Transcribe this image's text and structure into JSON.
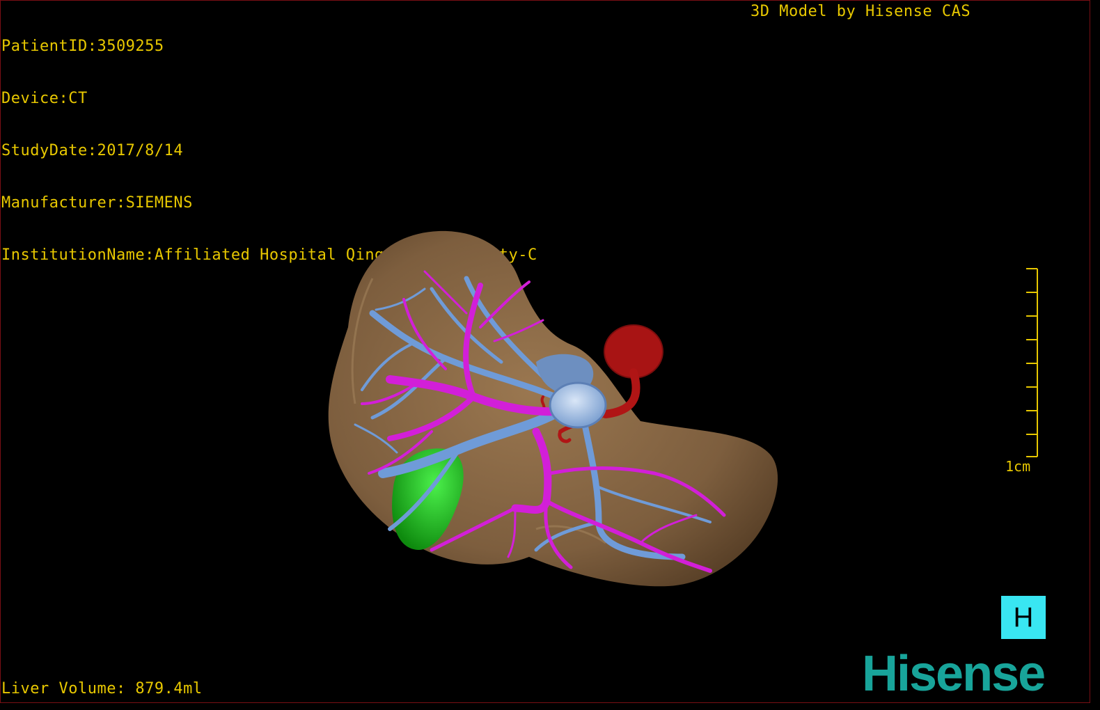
{
  "patient_info": {
    "patient_id": "PatientID:3509255",
    "device": "Device:CT",
    "study_date": "StudyDate:2017/8/14",
    "manufacturer": "Manufacturer:SIEMENS",
    "institution": "InstitutionName:Affiliated Hospital Qingdao University-C"
  },
  "credit": "3D Model by Hisense CAS",
  "liver_volume": "Liver Volume: 879.4ml",
  "scale_bar": {
    "label": "1cm"
  },
  "view_button": {
    "label": "H"
  },
  "brand": {
    "logo_text": "Hisense"
  },
  "colors": {
    "background": "#000000",
    "overlay_text": "#e8c800",
    "liver": "#8b6a48",
    "portal_vein": "#d21fd8",
    "hepatic_vein": "#6f9bd8",
    "artery": "#b01515",
    "gallbladder": "#1dbf1d",
    "view_button": "#39e6f2",
    "logo": "#18a49a"
  },
  "model": {
    "structures": [
      "liver-surface",
      "portal-vein",
      "hepatic-vein",
      "artery",
      "gallbladder"
    ]
  }
}
